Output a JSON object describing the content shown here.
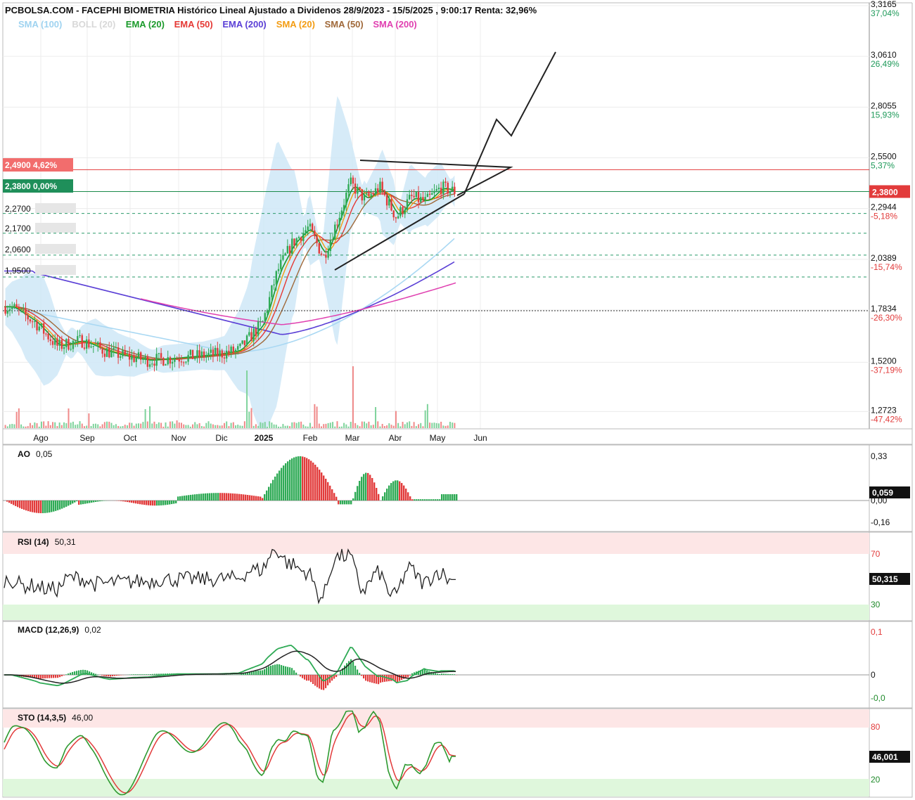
{
  "title": "PCBOLSA.COM - FACEPHI BIOMETRIA Histórico Lineal Ajustado a Dividenos 28/9/2023 - 15/5/2025 , 9:00:17 Renta: 32,96%",
  "legend": [
    {
      "label": "SMA (100)",
      "color": "#9fd3f0"
    },
    {
      "label": "BOLL (20)",
      "color": "#d8d8d8"
    },
    {
      "label": "EMA (20)",
      "color": "#1a9a2a"
    },
    {
      "label": "EMA (50)",
      "color": "#e53935"
    },
    {
      "label": "EMA (200)",
      "color": "#5a3fd6"
    },
    {
      "label": "SMA (20)",
      "color": "#f39c12"
    },
    {
      "label": "SMA (50)",
      "color": "#a0693a"
    },
    {
      "label": "SMA (200)",
      "color": "#e040b0"
    }
  ],
  "colors": {
    "up": "#2eaa55",
    "down": "#e23b3b",
    "band": "#cfe8f7",
    "red_level": "#e23b3b",
    "green_level": "#1a8a4a"
  },
  "price_axis": [
    {
      "price": "3,3165",
      "pct": "37,04%",
      "sign": "pos"
    },
    {
      "price": "3,0610",
      "pct": "26,49%",
      "sign": "pos"
    },
    {
      "price": "2,8055",
      "pct": "15,93%",
      "sign": "pos"
    },
    {
      "price": "2,5500",
      "pct": "5,37%",
      "sign": "pos"
    },
    {
      "price": "2,2944",
      "pct": "-5,18%",
      "sign": "neg"
    },
    {
      "price": "2,0389",
      "pct": "-15,74%",
      "sign": "neg"
    },
    {
      "price": "1,7834",
      "pct": "-26,30%",
      "sign": "neg"
    },
    {
      "price": "1,5200",
      "pct": "-37,19%",
      "sign": "neg"
    },
    {
      "price": "1,2723",
      "pct": "-47,42%",
      "sign": "neg"
    }
  ],
  "current_price_tag": "2,3800",
  "level_tags": [
    {
      "label": "2,4900",
      "pct": "4,62%",
      "type": "red"
    },
    {
      "label": "2,3800",
      "pct": "0,00%",
      "type": "green"
    },
    {
      "label": "2,2700",
      "pct": "",
      "type": "plain"
    },
    {
      "label": "2,1700",
      "pct": "",
      "type": "plain"
    },
    {
      "label": "2,0600",
      "pct": "",
      "type": "plain"
    },
    {
      "label": "1,9500",
      "pct": "",
      "type": "plain"
    }
  ],
  "months": [
    "Ago",
    "Sep",
    "Oct",
    "Nov",
    "Dic",
    "2025",
    "Feb",
    "Mar",
    "Abr",
    "May",
    "Jun"
  ],
  "indicators": {
    "ao": {
      "label": "AO",
      "value": "0,05",
      "ticks": [
        "0,33",
        "0,00",
        "-0,16"
      ],
      "tag": "0,059"
    },
    "rsi": {
      "label": "RSI (14)",
      "value": "50,31",
      "ticks": [
        "70",
        "30"
      ],
      "tag": "50,315"
    },
    "macd": {
      "label": "MACD (12,26,9)",
      "value": "0,02",
      "ticks": [
        "0,1",
        "0",
        "-0,0"
      ]
    },
    "sto": {
      "label": "STO (14,3,5)",
      "value": "46,00",
      "ticks": [
        "80",
        "20"
      ],
      "tag": "46,001"
    }
  },
  "chart_data": {
    "type": "candlestick",
    "title": "PCBOLSA.COM - FACEPHI BIOMETRIA Histórico Lineal Ajustado a Dividenos 28/9/2023 - 15/5/2025 , 9:00:17 Renta: 32,96%",
    "x_period": [
      "Ago 2024",
      "May 2025"
    ],
    "close_path": [
      [
        "2024-07-20",
        1.8
      ],
      [
        "2024-08-05",
        1.72
      ],
      [
        "2024-08-20",
        1.6
      ],
      [
        "2024-09-05",
        1.63
      ],
      [
        "2024-09-20",
        1.58
      ],
      [
        "2024-10-05",
        1.55
      ],
      [
        "2024-10-20",
        1.53
      ],
      [
        "2024-11-05",
        1.54
      ],
      [
        "2024-11-20",
        1.55
      ],
      [
        "2024-12-05",
        1.56
      ],
      [
        "2024-12-20",
        1.58
      ],
      [
        "2025-01-05",
        1.72
      ],
      [
        "2025-01-15",
        1.98
      ],
      [
        "2025-01-25",
        2.12
      ],
      [
        "2025-02-05",
        2.2
      ],
      [
        "2025-02-15",
        2.05
      ],
      [
        "2025-02-25",
        2.25
      ],
      [
        "2025-03-05",
        2.42
      ],
      [
        "2025-03-15",
        2.34
      ],
      [
        "2025-03-25",
        2.4
      ],
      [
        "2025-04-05",
        2.25
      ],
      [
        "2025-04-15",
        2.35
      ],
      [
        "2025-04-25",
        2.33
      ],
      [
        "2025-05-05",
        2.4
      ],
      [
        "2025-05-15",
        2.38
      ]
    ],
    "horizontal_levels": [
      2.49,
      2.38,
      2.27,
      2.17,
      2.06,
      1.95,
      1.78
    ],
    "moving_averages_end": {
      "EMA (200)": 2.03,
      "SMA (200)": 1.92,
      "SMA (100)": 2.15
    },
    "y_axis_range": [
      1.27,
      3.32
    ],
    "indicators_last": {
      "AO": 0.05,
      "RSI (14)": 50.31,
      "MACD (12,26,9)": 0.02,
      "STO (14,3,5)": 46.0
    }
  }
}
